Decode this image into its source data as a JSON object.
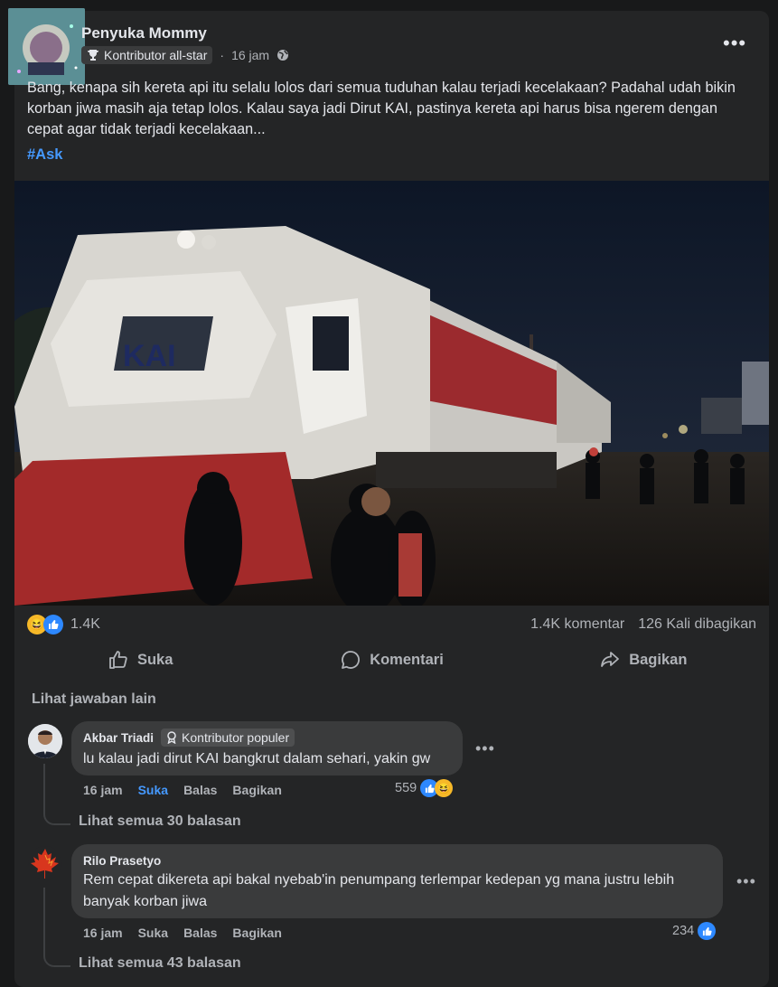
{
  "post": {
    "author": "Penyuka Mommy",
    "badge": "Kontributor all-star",
    "time": "16 jam",
    "text": "Bang, kenapa sih kereta api itu selalu lolos dari semua tuduhan kalau terjadi kecelakaan? Padahal udah bikin korban jiwa masih aja tetap lolos. Kalau saya jadi Dirut KAI, pastinya kereta api harus bisa ngerem dengan cepat agar tidak terjadi kecelakaan...",
    "hashtag": "#Ask",
    "reactions_count": "1.4K",
    "comments_count": "1.4K komentar",
    "shares_count": "126 Kali dibagikan"
  },
  "actions": {
    "like": "Suka",
    "comment": "Komentari",
    "share": "Bagikan"
  },
  "more_answers": "Lihat jawaban lain",
  "photo": {
    "logo_text": "KAI"
  },
  "comments": [
    {
      "name": "Akbar Triadi",
      "badge": "Kontributor populer",
      "text": "lu kalau jadi dirut KAI bangkrut dalam sehari, yakin gw",
      "time": "16 jam",
      "like": "Suka",
      "reply": "Balas",
      "share": "Bagikan",
      "reactions": "559",
      "replies": "Lihat semua 30 balasan"
    },
    {
      "name": "Rilo Prasetyo",
      "text": "Rem cepat dikereta api bakal nyebab'in penumpang terlempar kedepan yg mana justru lebih banyak korban jiwa",
      "time": "16 jam",
      "like": "Suka",
      "reply": "Balas",
      "share": "Bagikan",
      "reactions": "234",
      "replies": "Lihat semua 43 balasan"
    }
  ],
  "colors": {
    "background": "#18191a",
    "card": "#242526",
    "link": "#4599ff",
    "bubble": "#3a3b3c",
    "text_muted": "#b0b3b8"
  }
}
